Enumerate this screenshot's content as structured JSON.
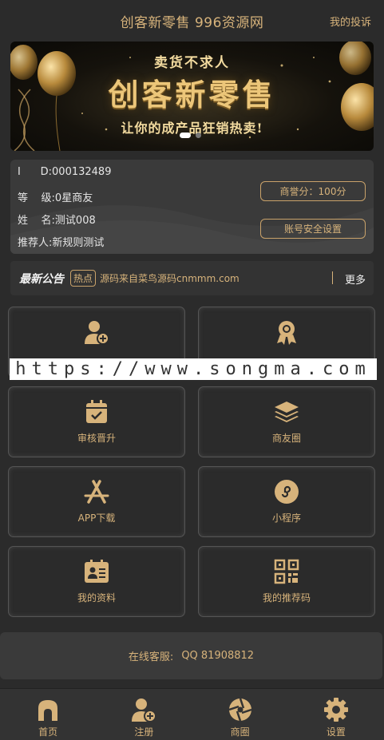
{
  "header": {
    "title": "创客新零售 996资源网",
    "complaint_link": "我的投诉"
  },
  "banner": {
    "top_text": "卖货不求人",
    "main_text": "创客新零售",
    "sub_text": "让你的成产品狂销热卖!",
    "slide_count": 2,
    "active_slide": 1
  },
  "user": {
    "id_label": "I      D:",
    "id_value": "000132489",
    "level_label": "等    级:",
    "level_value": "0星商友",
    "name_label": "姓    名:",
    "name_value": "测试008",
    "referrer_label": "推荐人:",
    "referrer_value": "新规则测试",
    "reputation_button": "商誉分：100分",
    "security_button": "账号安全设置"
  },
  "notice": {
    "title": "最新公告",
    "hot_badge": "热点",
    "text": "源码来自菜鸟源码cnmmm.com",
    "more": "更多"
  },
  "grid": [
    {
      "icon": "add-user-icon",
      "label": ""
    },
    {
      "icon": "award-icon",
      "label": ""
    },
    {
      "icon": "calendar-check-icon",
      "label": "审核晋升"
    },
    {
      "icon": "layers-icon",
      "label": "商友圈"
    },
    {
      "icon": "app-store-icon",
      "label": "APP下载"
    },
    {
      "icon": "mini-program-icon",
      "label": "小程序"
    },
    {
      "icon": "profile-card-icon",
      "label": "我的资料"
    },
    {
      "icon": "qr-code-icon",
      "label": "我的推荐码"
    }
  ],
  "watermark": "https://www.songma.com",
  "service": {
    "label": "在线客服:",
    "value": "QQ 81908812"
  },
  "tabbar": [
    {
      "icon": "home-icon",
      "label": "首页"
    },
    {
      "icon": "register-icon",
      "label": "注册"
    },
    {
      "icon": "shutter-icon",
      "label": "商圈"
    },
    {
      "icon": "gear-icon",
      "label": "设置"
    }
  ],
  "colors": {
    "background": "#2b2b2b",
    "accent_gold": "#d7b37b",
    "card": "#3a3a3a"
  }
}
